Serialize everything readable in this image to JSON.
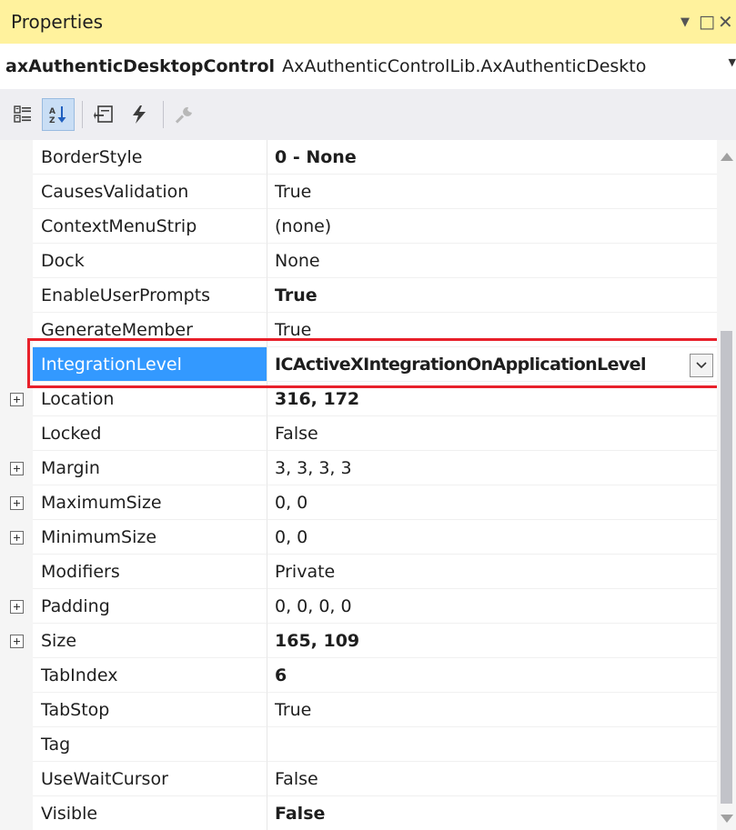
{
  "window": {
    "title": "Properties",
    "icons": [
      "dropdown-arrow-icon",
      "maximize-icon",
      "close-icon"
    ]
  },
  "object_selector": {
    "name": "axAuthenticDesktopControl",
    "type": "AxAuthenticControlLib.AxAuthenticDeskto"
  },
  "toolbar": {
    "buttons": [
      "categorized-icon",
      "alphabetical-icon",
      "properties-icon",
      "events-icon",
      "property-pages-icon"
    ],
    "active": "alphabetical-icon"
  },
  "properties": [
    {
      "name": "BorderStyle",
      "value": "0 - None",
      "bold": true,
      "expandable": false
    },
    {
      "name": "CausesValidation",
      "value": "True",
      "bold": false,
      "expandable": false
    },
    {
      "name": "ContextMenuStrip",
      "value": "(none)",
      "bold": false,
      "expandable": false
    },
    {
      "name": "Dock",
      "value": "None",
      "bold": false,
      "expandable": false
    },
    {
      "name": "EnableUserPrompts",
      "value": "True",
      "bold": true,
      "expandable": false
    },
    {
      "name": "GenerateMember",
      "value": "True",
      "bold": false,
      "expandable": false
    },
    {
      "name": "IntegrationLevel",
      "value": "ICActiveXIntegrationOnApplicationLevel",
      "bold": true,
      "expandable": false,
      "selected": true
    },
    {
      "name": "Location",
      "value": "316, 172",
      "bold": true,
      "expandable": true
    },
    {
      "name": "Locked",
      "value": "False",
      "bold": false,
      "expandable": false
    },
    {
      "name": "Margin",
      "value": "3, 3, 3, 3",
      "bold": false,
      "expandable": true
    },
    {
      "name": "MaximumSize",
      "value": "0, 0",
      "bold": false,
      "expandable": true
    },
    {
      "name": "MinimumSize",
      "value": "0, 0",
      "bold": false,
      "expandable": true
    },
    {
      "name": "Modifiers",
      "value": "Private",
      "bold": false,
      "expandable": false
    },
    {
      "name": "Padding",
      "value": "0, 0, 0, 0",
      "bold": false,
      "expandable": true
    },
    {
      "name": "Size",
      "value": "165, 109",
      "bold": true,
      "expandable": true
    },
    {
      "name": "TabIndex",
      "value": "6",
      "bold": true,
      "expandable": false
    },
    {
      "name": "TabStop",
      "value": "True",
      "bold": false,
      "expandable": false
    },
    {
      "name": "Tag",
      "value": "",
      "bold": false,
      "expandable": false
    },
    {
      "name": "UseWaitCursor",
      "value": "False",
      "bold": false,
      "expandable": false
    },
    {
      "name": "Visible",
      "value": "False",
      "bold": true,
      "expandable": false
    }
  ],
  "colors": {
    "titlebar": "#fff29d",
    "selection": "#3399ff",
    "highlight_box": "#e8202a"
  }
}
